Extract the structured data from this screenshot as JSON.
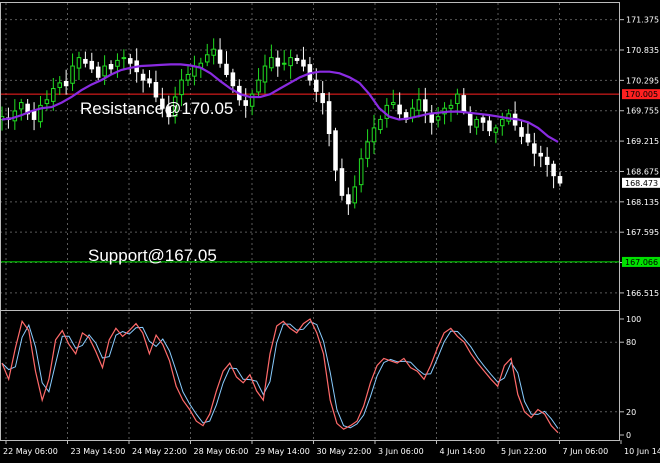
{
  "chart_data": [
    {
      "type": "candlestick",
      "panel": "price",
      "ylim": [
        166.3,
        171.6
      ],
      "y_ticks": [
        "171.375",
        "170.835",
        "170.295",
        "169.755",
        "169.215",
        "168.675",
        "168.135",
        "167.595",
        "167.055",
        "166.515"
      ],
      "x_ticks": [
        "22 May 06:00",
        "23 May 14:00",
        "24 May 22:00",
        "28 May 06:00",
        "29 May 14:00",
        "30 May 22:00",
        "3 Jun 06:00",
        "4 Jun 14:00",
        "5 Jun 22:00",
        "7 Jun 06:00",
        "10 Jun 14:00"
      ],
      "colors": {
        "up": "#22dd22",
        "down": "#ffffff",
        "ma": "#8a2be2",
        "resistance": "#ff2020",
        "support": "#00e000",
        "grid": "#5a5a5a"
      },
      "close_path": [
        169.65,
        169.6,
        169.75,
        169.9,
        169.7,
        169.6,
        169.85,
        169.95,
        170.15,
        170.25,
        170.2,
        170.55,
        170.7,
        170.6,
        170.5,
        170.35,
        170.55,
        170.5,
        170.65,
        170.7,
        170.6,
        170.45,
        170.3,
        170.25,
        170.0,
        169.8,
        169.65,
        170.0,
        170.3,
        170.4,
        170.55,
        170.6,
        170.75,
        170.85,
        170.6,
        170.4,
        170.2,
        169.95,
        169.85,
        170.05,
        170.3,
        170.55,
        170.7,
        170.55,
        170.6,
        170.7,
        170.65,
        170.55,
        170.3,
        170.1,
        169.9,
        169.35,
        168.7,
        168.25,
        168.1,
        168.4,
        168.9,
        169.2,
        169.45,
        169.6,
        169.85,
        169.9,
        169.7,
        169.6,
        169.8,
        169.95,
        169.75,
        169.55,
        169.65,
        169.8,
        169.85,
        170.05,
        169.75,
        169.5,
        169.6,
        169.55,
        169.4,
        169.45,
        169.6,
        169.7,
        169.5,
        169.3,
        169.2,
        169.0,
        168.95,
        168.8,
        168.6,
        168.47
      ],
      "ma_path": [
        169.6,
        169.62,
        169.68,
        169.75,
        169.8,
        169.82,
        169.9,
        170.0,
        170.12,
        170.22,
        170.3,
        170.4,
        170.48,
        170.52,
        170.55,
        170.56,
        170.57,
        170.58,
        170.58,
        170.56,
        170.52,
        170.42,
        170.28,
        170.15,
        170.05,
        170.0,
        170.0,
        170.05,
        170.15,
        170.25,
        170.35,
        170.42,
        170.45,
        170.45,
        170.42,
        170.35,
        170.25,
        170.05,
        169.8,
        169.65,
        169.6,
        169.62,
        169.66,
        169.7,
        169.72,
        169.74,
        169.74,
        169.72,
        169.7,
        169.68,
        169.65,
        169.62,
        169.6,
        169.55,
        169.45,
        169.3,
        169.2
      ],
      "current_price": "168.473",
      "levels": [
        {
          "label": "Resistance@170.05",
          "value": 170.05,
          "tag": "170.005",
          "kind": "resistance"
        },
        {
          "label": "Support@167.05",
          "value": 167.066,
          "tag": "167.066",
          "kind": "support"
        }
      ]
    },
    {
      "type": "line",
      "panel": "oscillator",
      "ylim": [
        0,
        100
      ],
      "y_ticks": [
        "100",
        "80",
        "20",
        "0"
      ],
      "colors": {
        "main": "#ff6a6a",
        "signal": "#88ccff"
      },
      "values": [
        62,
        48,
        75,
        98,
        90,
        55,
        30,
        48,
        82,
        90,
        78,
        70,
        88,
        84,
        72,
        58,
        82,
        92,
        85,
        90,
        96,
        88,
        70,
        86,
        78,
        64,
        42,
        30,
        22,
        12,
        8,
        18,
        38,
        55,
        62,
        50,
        45,
        52,
        38,
        30,
        70,
        94,
        98,
        92,
        88,
        96,
        100,
        88,
        70,
        30,
        10,
        5,
        8,
        12,
        25,
        45,
        60,
        66,
        64,
        62,
        66,
        58,
        55,
        48,
        60,
        75,
        88,
        92,
        85,
        80,
        70,
        62,
        55,
        48,
        42,
        60,
        66,
        35,
        20,
        15,
        22,
        18,
        8,
        2
      ]
    }
  ]
}
